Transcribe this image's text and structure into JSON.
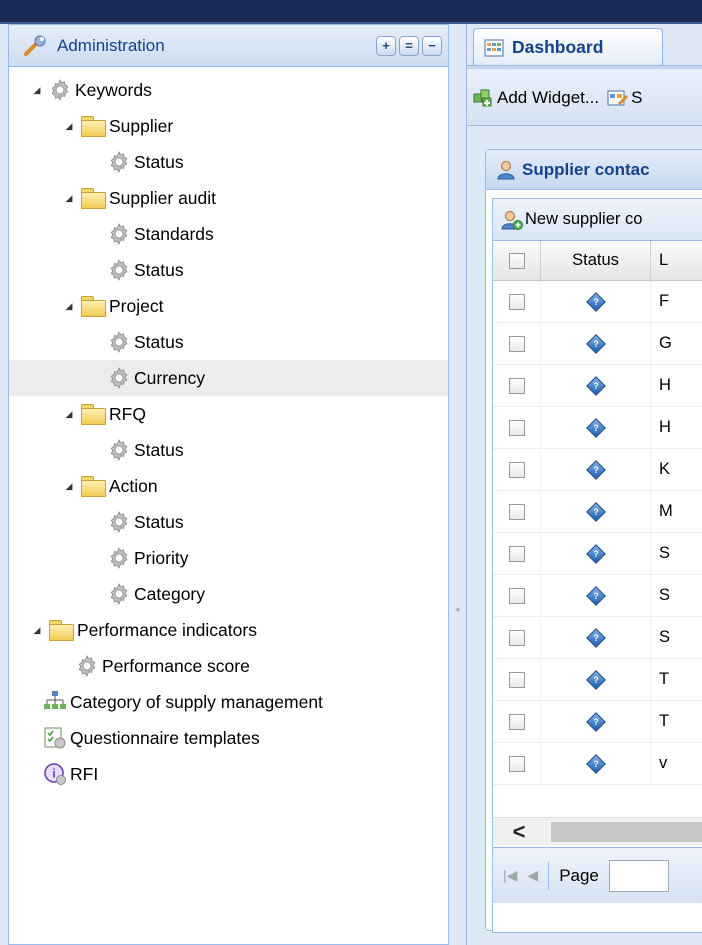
{
  "sidebar": {
    "title": "Administration",
    "buttons": [
      "+",
      "=",
      "−"
    ],
    "tree": [
      {
        "label": "Keywords",
        "indent": 0,
        "kind": "gear",
        "arrow": true
      },
      {
        "label": "Supplier",
        "indent": 1,
        "kind": "folder",
        "arrow": true
      },
      {
        "label": "Status",
        "indent": 2,
        "kind": "gear",
        "arrow": false
      },
      {
        "label": "Supplier audit",
        "indent": 1,
        "kind": "folder",
        "arrow": true
      },
      {
        "label": "Standards",
        "indent": 2,
        "kind": "gear",
        "arrow": false
      },
      {
        "label": "Status",
        "indent": 2,
        "kind": "gear",
        "arrow": false
      },
      {
        "label": "Project",
        "indent": 1,
        "kind": "folder",
        "arrow": true
      },
      {
        "label": "Status",
        "indent": 2,
        "kind": "gear",
        "arrow": false
      },
      {
        "label": "Currency",
        "indent": 2,
        "kind": "gear",
        "arrow": false,
        "selected": true
      },
      {
        "label": "RFQ",
        "indent": 1,
        "kind": "folder",
        "arrow": true
      },
      {
        "label": "Status",
        "indent": 2,
        "kind": "gear",
        "arrow": false
      },
      {
        "label": "Action",
        "indent": 1,
        "kind": "folder",
        "arrow": true
      },
      {
        "label": "Status",
        "indent": 2,
        "kind": "gear",
        "arrow": false
      },
      {
        "label": "Priority",
        "indent": 2,
        "kind": "gear",
        "arrow": false
      },
      {
        "label": "Category",
        "indent": 2,
        "kind": "gear",
        "arrow": false
      },
      {
        "label": "Performance indicators",
        "indent": 0,
        "kind": "folder",
        "arrow": true
      },
      {
        "label": "Performance score",
        "indent": 1,
        "kind": "gear",
        "arrow": false
      },
      {
        "label": "Category of supply management",
        "indent": 0,
        "kind": "org",
        "arrow": false
      },
      {
        "label": "Questionnaire templates",
        "indent": 0,
        "kind": "quest",
        "arrow": false
      },
      {
        "label": "RFI",
        "indent": 0,
        "kind": "rfi",
        "arrow": false
      }
    ]
  },
  "main": {
    "tab_label": "Dashboard",
    "toolbar": {
      "add_widget": "Add Widget...",
      "second": "S"
    },
    "widget": {
      "title": "Supplier contac",
      "new_button": "New supplier co",
      "columns": {
        "status": "Status",
        "third": "L"
      },
      "rows": [
        "F",
        "G",
        "H",
        "H",
        "K",
        "M",
        "S",
        "S",
        "S",
        "T",
        "T",
        "v"
      ],
      "pager_label": "Page"
    }
  },
  "colors": {
    "accent": "#15428b",
    "border": "#99bbe8",
    "panel_bg": "#dfe8f6"
  }
}
